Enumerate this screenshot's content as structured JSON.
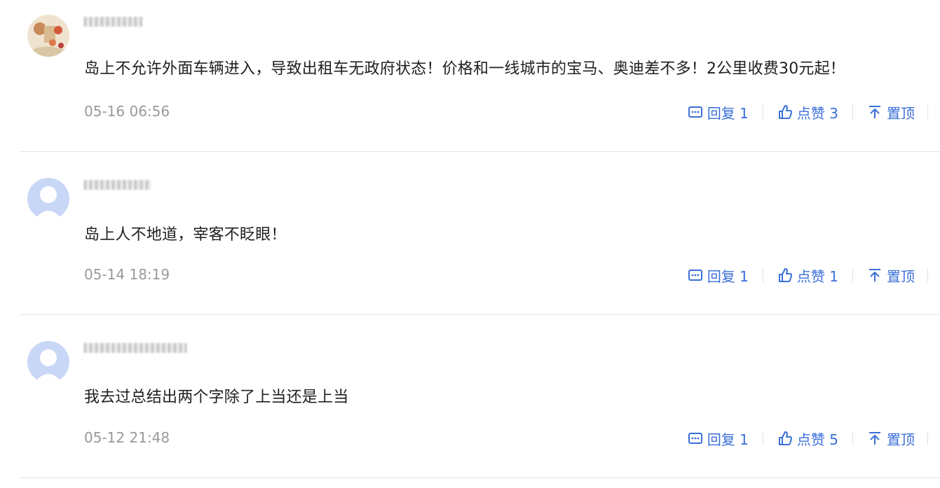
{
  "comments": [
    {
      "text": "岛上不允许外面车辆进入，导致出租车无政府状态！价格和一线城市的宝马、奥迪差不多！2公里收费30元起！",
      "time": "05-16 06:56",
      "reply_label": "回复 1",
      "like_label": "点赞 3",
      "pin_label": "置顶"
    },
    {
      "text": "岛上人不地道，宰客不眨眼！",
      "time": "05-14 18:19",
      "reply_label": "回复 1",
      "like_label": "点赞 1",
      "pin_label": "置顶"
    },
    {
      "text": "我去过总结出两个字除了上当还是上当",
      "time": "05-12 21:48",
      "reply_label": "回复 1",
      "like_label": "点赞 5",
      "pin_label": "置顶"
    }
  ],
  "colors": {
    "accent": "#3a6fd8",
    "meta": "#999999",
    "divider": "#e6e6e6",
    "default_avatar": "#c9d7f7"
  }
}
